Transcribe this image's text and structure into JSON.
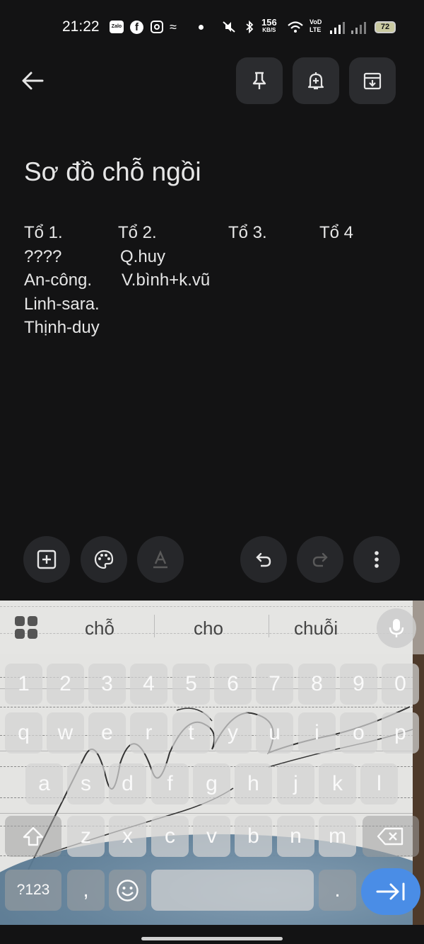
{
  "status_bar": {
    "time": "21:22",
    "app_icons": [
      "zalo-icon",
      "facebook-icon",
      "instagram-icon",
      "swirl-app-icon"
    ],
    "zalo_label": "Zalo",
    "speed": "156",
    "speed_unit": "KB/S",
    "volte": "VoD",
    "lte": "LTE",
    "battery": "72"
  },
  "top_bar": {
    "icons": [
      "arrow-back-icon",
      "pin-icon",
      "reminder-bell-icon",
      "archive-icon"
    ]
  },
  "note": {
    "title": "Sơ đồ chỗ ngồi",
    "rows": [
      [
        "Tổ 1.",
        "Tổ 2.",
        "Tổ 3.",
        "Tổ 4"
      ],
      [
        "????",
        "Q.huy",
        "",
        ""
      ],
      [
        "An-công.",
        "V.bình+k.vũ",
        "",
        ""
      ],
      [
        "Linh-sara.",
        "",
        "",
        ""
      ],
      [
        "Thịnh-duy",
        "",
        "",
        ""
      ]
    ]
  },
  "editor_toolbar": {
    "icons": [
      "add-box-icon",
      "palette-icon",
      "text-format-icon",
      "undo-icon",
      "redo-icon",
      "more-vert-icon"
    ]
  },
  "keyboard": {
    "suggestions": [
      "chỗ",
      "cho",
      "chuỗi"
    ],
    "number_row": [
      "1",
      "2",
      "3",
      "4",
      "5",
      "6",
      "7",
      "8",
      "9",
      "0"
    ],
    "row1": [
      "q",
      "w",
      "e",
      "r",
      "t",
      "y",
      "u",
      "i",
      "o",
      "p"
    ],
    "row2": [
      "a",
      "s",
      "d",
      "f",
      "g",
      "h",
      "j",
      "k",
      "l"
    ],
    "row3": [
      "z",
      "x",
      "c",
      "v",
      "b",
      "n",
      "m"
    ],
    "symbols_key": "?123",
    "comma_key": ",",
    "period_key": ".",
    "icons": [
      "apps-grid-icon",
      "mic-icon",
      "shift-icon",
      "backspace-icon",
      "emoji-icon",
      "enter-arrow-icon"
    ]
  }
}
